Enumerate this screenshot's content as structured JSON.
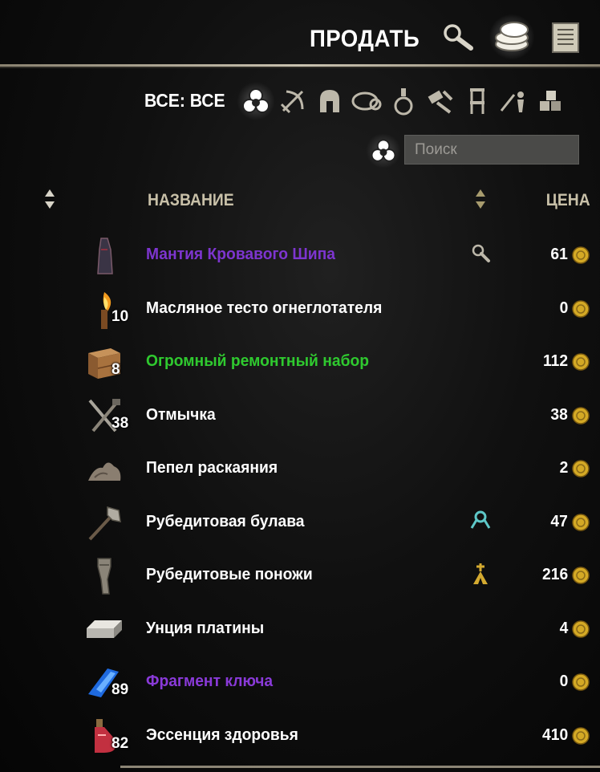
{
  "header": {
    "title": "ПРОДАТЬ"
  },
  "filter": {
    "label": "ВСЕ: ВСЕ",
    "tabs": [
      "all",
      "weapons",
      "armor",
      "jewelry",
      "consumables",
      "materials",
      "furnishings",
      "companion",
      "misc"
    ],
    "active_tab": "all"
  },
  "search": {
    "placeholder": "Поиск"
  },
  "columns": {
    "name": "НАЗВАНИЕ",
    "price": "ЦЕНА"
  },
  "colors": {
    "white": "#ffffff",
    "purple": "#8a3ad9",
    "green": "#2fc92f",
    "header": "#c8c0a8"
  },
  "items": [
    {
      "name": "Мантия Кровавого Шипа",
      "quantity": "",
      "price": "61",
      "color": "#7d35cf",
      "icon": "robe-icon",
      "trait": "research-icon"
    },
    {
      "name": "Масляное тесто огнеглотателя",
      "quantity": "10",
      "price": "0",
      "color": "#ffffff",
      "icon": "torch-icon",
      "trait": ""
    },
    {
      "name": "Огромный ремонтный набор",
      "quantity": "8",
      "price": "112",
      "color": "#2fc92f",
      "icon": "repair-crate-icon",
      "trait": ""
    },
    {
      "name": "Отмычка",
      "quantity": "38",
      "price": "38",
      "color": "#ffffff",
      "icon": "lockpick-icon",
      "trait": ""
    },
    {
      "name": "Пепел раскаяния",
      "quantity": "",
      "price": "2",
      "color": "#ffffff",
      "icon": "ash-icon",
      "trait": ""
    },
    {
      "name": "Рубедитовая булава",
      "quantity": "",
      "price": "47",
      "color": "#ffffff",
      "icon": "mace-icon",
      "trait": "set-item-icon"
    },
    {
      "name": "Рубедитовые поножи",
      "quantity": "",
      "price": "216",
      "color": "#ffffff",
      "icon": "greaves-icon",
      "trait": "ornate-icon"
    },
    {
      "name": "Унция платины",
      "quantity": "",
      "price": "4",
      "color": "#ffffff",
      "icon": "ingot-icon",
      "trait": ""
    },
    {
      "name": "Фрагмент ключа",
      "quantity": "89",
      "price": "0",
      "color": "#8a3ad9",
      "icon": "key-fragment-icon",
      "trait": ""
    },
    {
      "name": "Эссенция здоровья",
      "quantity": "82",
      "price": "410",
      "color": "#ffffff",
      "icon": "potion-icon",
      "trait": ""
    }
  ]
}
